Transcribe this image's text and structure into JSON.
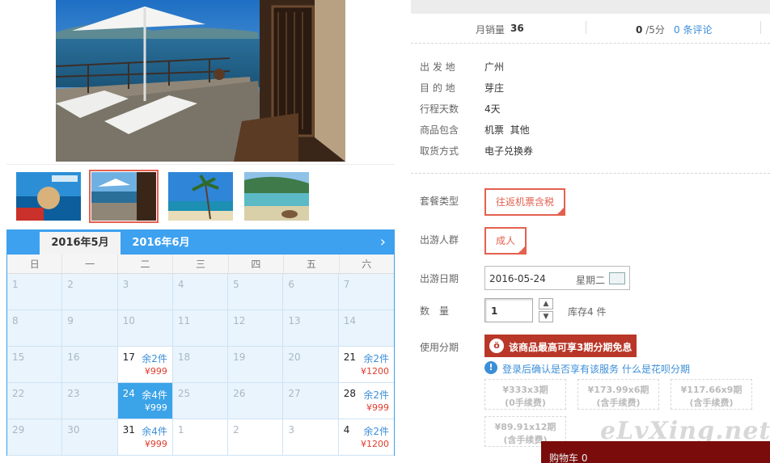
{
  "stats": {
    "sales_label": "月销量",
    "sales_value": "36",
    "score_value": "0",
    "score_total": "/5分",
    "reviews_link": "0 条评论"
  },
  "details": [
    {
      "label": "出 发 地",
      "value": "广州"
    },
    {
      "label": "目 的 地",
      "value": "芽庄"
    },
    {
      "label": "行程天数",
      "value": "4天"
    },
    {
      "label": "商品包含",
      "value": "机票  其他"
    },
    {
      "label": "取货方式",
      "value": "电子兑换券"
    }
  ],
  "options": {
    "package_label": "套餐类型",
    "package_value": "往返机票含税",
    "crowd_label": "出游人群",
    "crowd_value": "成人",
    "date_label": "出游日期",
    "date_value": "2016-05-24",
    "date_weekday": "星期二",
    "qty_label": "数　量",
    "qty_value": "1",
    "stock_text": "库存4 件",
    "installment_label": "使用分期",
    "installment_banner": "该商品最高可享3期分期免息"
  },
  "installment_info": {
    "login_text": "登录后确认是否享有该服务",
    "huabei_link": "什么是花呗分期"
  },
  "plans": [
    {
      "amount": "¥333x3期",
      "fee": "(0手续费)"
    },
    {
      "amount": "¥173.99x6期",
      "fee": "(含手续费)"
    },
    {
      "amount": "¥117.66x9期",
      "fee": "(含手续费)"
    },
    {
      "amount": "¥89.91x12期",
      "fee": "(含手续费)"
    }
  ],
  "calendar": {
    "tabs": [
      "2016年5月",
      "2016年6月"
    ],
    "next": "›",
    "weekdays": [
      "日",
      "一",
      "二",
      "三",
      "四",
      "五",
      "六"
    ],
    "rows": [
      [
        {
          "d": "1"
        },
        {
          "d": "2"
        },
        {
          "d": "3"
        },
        {
          "d": "4"
        },
        {
          "d": "5"
        },
        {
          "d": "6"
        },
        {
          "d": "7"
        }
      ],
      [
        {
          "d": "8"
        },
        {
          "d": "9"
        },
        {
          "d": "10"
        },
        {
          "d": "11"
        },
        {
          "d": "12"
        },
        {
          "d": "13"
        },
        {
          "d": "14"
        }
      ],
      [
        {
          "d": "15"
        },
        {
          "d": "16"
        },
        {
          "d": "17",
          "stock": "余2件",
          "price": "¥999"
        },
        {
          "d": "18"
        },
        {
          "d": "19"
        },
        {
          "d": "20"
        },
        {
          "d": "21",
          "stock": "余2件",
          "price": "¥1200"
        }
      ],
      [
        {
          "d": "22"
        },
        {
          "d": "23"
        },
        {
          "d": "24",
          "stock": "余4件",
          "price": "¥999",
          "selected": true
        },
        {
          "d": "25"
        },
        {
          "d": "26"
        },
        {
          "d": "27"
        },
        {
          "d": "28",
          "stock": "余2件",
          "price": "¥999"
        }
      ],
      [
        {
          "d": "29"
        },
        {
          "d": "30"
        },
        {
          "d": "31",
          "stock": "余4件",
          "price": "¥999"
        },
        {
          "d": "1",
          "other": true
        },
        {
          "d": "2",
          "other": true
        },
        {
          "d": "3",
          "other": true
        },
        {
          "d": "4",
          "stock": "余2件",
          "price": "¥1200",
          "other": true
        }
      ]
    ]
  },
  "watermark": "eLvXing.net",
  "cart": {
    "label": "购物车 0"
  },
  "colors": {
    "accent_red": "#e4614f",
    "link_blue": "#3b8ed8",
    "calendar_blue": "#3ea1f0",
    "price_red": "#e03c2e",
    "installment_red": "#b93728"
  }
}
